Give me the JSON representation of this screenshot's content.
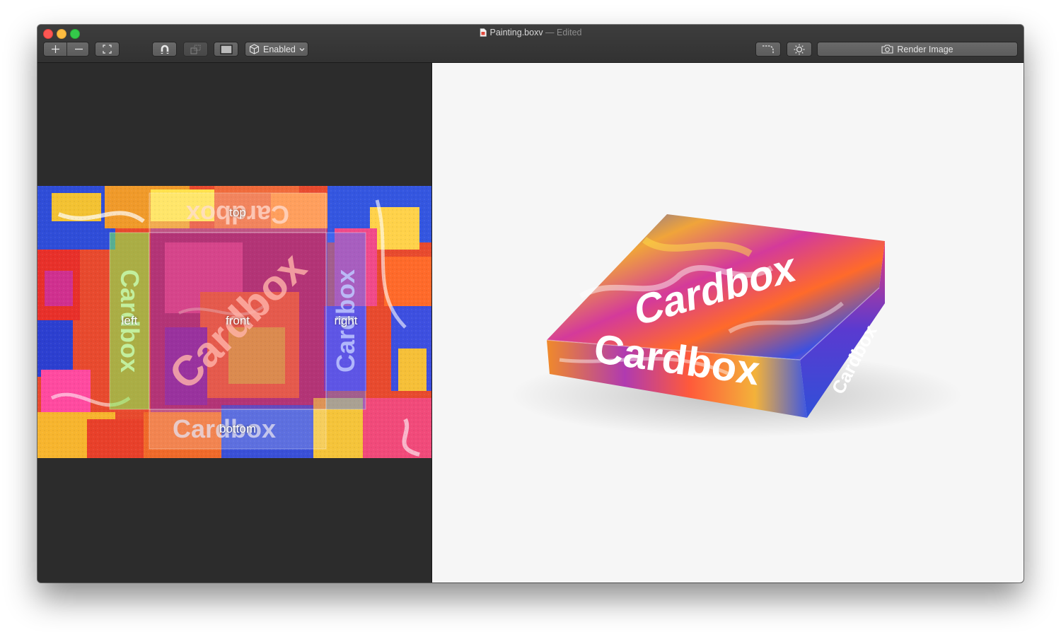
{
  "window": {
    "document_name": "Painting.boxv",
    "separator": " — ",
    "status": "Edited"
  },
  "toolbar": {
    "zoom_in": {
      "icon": "plus-icon",
      "glyph": "+"
    },
    "zoom_out": {
      "icon": "minus-icon",
      "glyph": "−"
    },
    "fit": {
      "icon": "fit-icon"
    },
    "magnet": {
      "icon": "magnet-icon"
    },
    "arrange": {
      "icon": "arrange-icon"
    },
    "frame": {
      "icon": "frame-icon"
    },
    "mode_dropdown": {
      "icon": "box-icon",
      "selected": "Enabled"
    },
    "corner": {
      "icon": "rounded-corner-icon"
    },
    "lighting": {
      "icon": "sun-icon"
    },
    "render": {
      "icon": "camera-icon",
      "label": "Render Image"
    }
  },
  "texture_editor": {
    "brand_text": "Cardbox",
    "faces": {
      "top": "top",
      "left": "left",
      "front": "front",
      "right": "right",
      "bottom": "bottom"
    }
  },
  "preview": {
    "brand_text": "Cardbox"
  },
  "colors": {
    "titlebar": "#353535",
    "editor_bg": "#2c2c2c",
    "preview_bg": "#f6f6f6",
    "close": "#fc5753",
    "minimize": "#fdbc40",
    "zoom": "#34c84a"
  }
}
